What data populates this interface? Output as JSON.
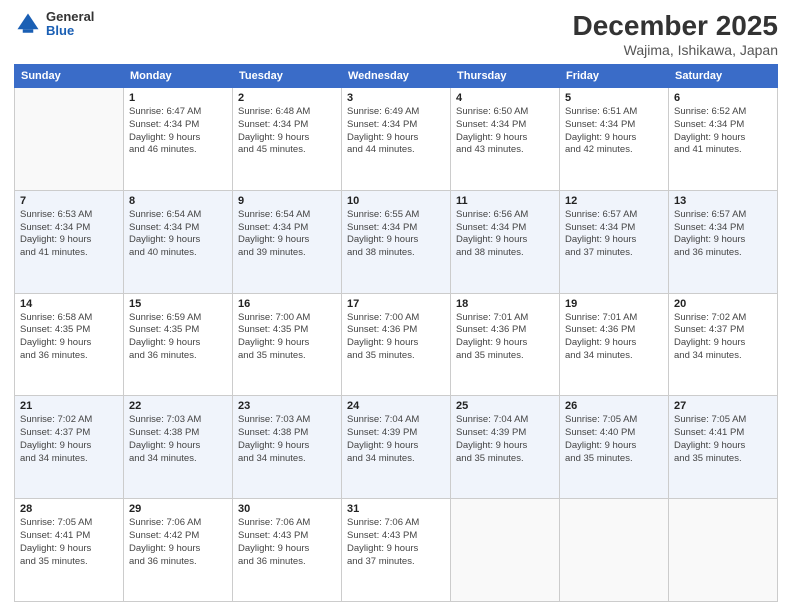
{
  "header": {
    "logo": {
      "general": "General",
      "blue": "Blue"
    },
    "title": "December 2025",
    "subtitle": "Wajima, Ishikawa, Japan"
  },
  "weekdays": [
    "Sunday",
    "Monday",
    "Tuesday",
    "Wednesday",
    "Thursday",
    "Friday",
    "Saturday"
  ],
  "weeks": [
    [
      {
        "day": "",
        "detail": ""
      },
      {
        "day": "1",
        "detail": "Sunrise: 6:47 AM\nSunset: 4:34 PM\nDaylight: 9 hours\nand 46 minutes."
      },
      {
        "day": "2",
        "detail": "Sunrise: 6:48 AM\nSunset: 4:34 PM\nDaylight: 9 hours\nand 45 minutes."
      },
      {
        "day": "3",
        "detail": "Sunrise: 6:49 AM\nSunset: 4:34 PM\nDaylight: 9 hours\nand 44 minutes."
      },
      {
        "day": "4",
        "detail": "Sunrise: 6:50 AM\nSunset: 4:34 PM\nDaylight: 9 hours\nand 43 minutes."
      },
      {
        "day": "5",
        "detail": "Sunrise: 6:51 AM\nSunset: 4:34 PM\nDaylight: 9 hours\nand 42 minutes."
      },
      {
        "day": "6",
        "detail": "Sunrise: 6:52 AM\nSunset: 4:34 PM\nDaylight: 9 hours\nand 41 minutes."
      }
    ],
    [
      {
        "day": "7",
        "detail": "Sunrise: 6:53 AM\nSunset: 4:34 PM\nDaylight: 9 hours\nand 41 minutes."
      },
      {
        "day": "8",
        "detail": "Sunrise: 6:54 AM\nSunset: 4:34 PM\nDaylight: 9 hours\nand 40 minutes."
      },
      {
        "day": "9",
        "detail": "Sunrise: 6:54 AM\nSunset: 4:34 PM\nDaylight: 9 hours\nand 39 minutes."
      },
      {
        "day": "10",
        "detail": "Sunrise: 6:55 AM\nSunset: 4:34 PM\nDaylight: 9 hours\nand 38 minutes."
      },
      {
        "day": "11",
        "detail": "Sunrise: 6:56 AM\nSunset: 4:34 PM\nDaylight: 9 hours\nand 38 minutes."
      },
      {
        "day": "12",
        "detail": "Sunrise: 6:57 AM\nSunset: 4:34 PM\nDaylight: 9 hours\nand 37 minutes."
      },
      {
        "day": "13",
        "detail": "Sunrise: 6:57 AM\nSunset: 4:34 PM\nDaylight: 9 hours\nand 36 minutes."
      }
    ],
    [
      {
        "day": "14",
        "detail": "Sunrise: 6:58 AM\nSunset: 4:35 PM\nDaylight: 9 hours\nand 36 minutes."
      },
      {
        "day": "15",
        "detail": "Sunrise: 6:59 AM\nSunset: 4:35 PM\nDaylight: 9 hours\nand 36 minutes."
      },
      {
        "day": "16",
        "detail": "Sunrise: 7:00 AM\nSunset: 4:35 PM\nDaylight: 9 hours\nand 35 minutes."
      },
      {
        "day": "17",
        "detail": "Sunrise: 7:00 AM\nSunset: 4:36 PM\nDaylight: 9 hours\nand 35 minutes."
      },
      {
        "day": "18",
        "detail": "Sunrise: 7:01 AM\nSunset: 4:36 PM\nDaylight: 9 hours\nand 35 minutes."
      },
      {
        "day": "19",
        "detail": "Sunrise: 7:01 AM\nSunset: 4:36 PM\nDaylight: 9 hours\nand 34 minutes."
      },
      {
        "day": "20",
        "detail": "Sunrise: 7:02 AM\nSunset: 4:37 PM\nDaylight: 9 hours\nand 34 minutes."
      }
    ],
    [
      {
        "day": "21",
        "detail": "Sunrise: 7:02 AM\nSunset: 4:37 PM\nDaylight: 9 hours\nand 34 minutes."
      },
      {
        "day": "22",
        "detail": "Sunrise: 7:03 AM\nSunset: 4:38 PM\nDaylight: 9 hours\nand 34 minutes."
      },
      {
        "day": "23",
        "detail": "Sunrise: 7:03 AM\nSunset: 4:38 PM\nDaylight: 9 hours\nand 34 minutes."
      },
      {
        "day": "24",
        "detail": "Sunrise: 7:04 AM\nSunset: 4:39 PM\nDaylight: 9 hours\nand 34 minutes."
      },
      {
        "day": "25",
        "detail": "Sunrise: 7:04 AM\nSunset: 4:39 PM\nDaylight: 9 hours\nand 35 minutes."
      },
      {
        "day": "26",
        "detail": "Sunrise: 7:05 AM\nSunset: 4:40 PM\nDaylight: 9 hours\nand 35 minutes."
      },
      {
        "day": "27",
        "detail": "Sunrise: 7:05 AM\nSunset: 4:41 PM\nDaylight: 9 hours\nand 35 minutes."
      }
    ],
    [
      {
        "day": "28",
        "detail": "Sunrise: 7:05 AM\nSunset: 4:41 PM\nDaylight: 9 hours\nand 35 minutes."
      },
      {
        "day": "29",
        "detail": "Sunrise: 7:06 AM\nSunset: 4:42 PM\nDaylight: 9 hours\nand 36 minutes."
      },
      {
        "day": "30",
        "detail": "Sunrise: 7:06 AM\nSunset: 4:43 PM\nDaylight: 9 hours\nand 36 minutes."
      },
      {
        "day": "31",
        "detail": "Sunrise: 7:06 AM\nSunset: 4:43 PM\nDaylight: 9 hours\nand 37 minutes."
      },
      {
        "day": "",
        "detail": ""
      },
      {
        "day": "",
        "detail": ""
      },
      {
        "day": "",
        "detail": ""
      }
    ]
  ]
}
